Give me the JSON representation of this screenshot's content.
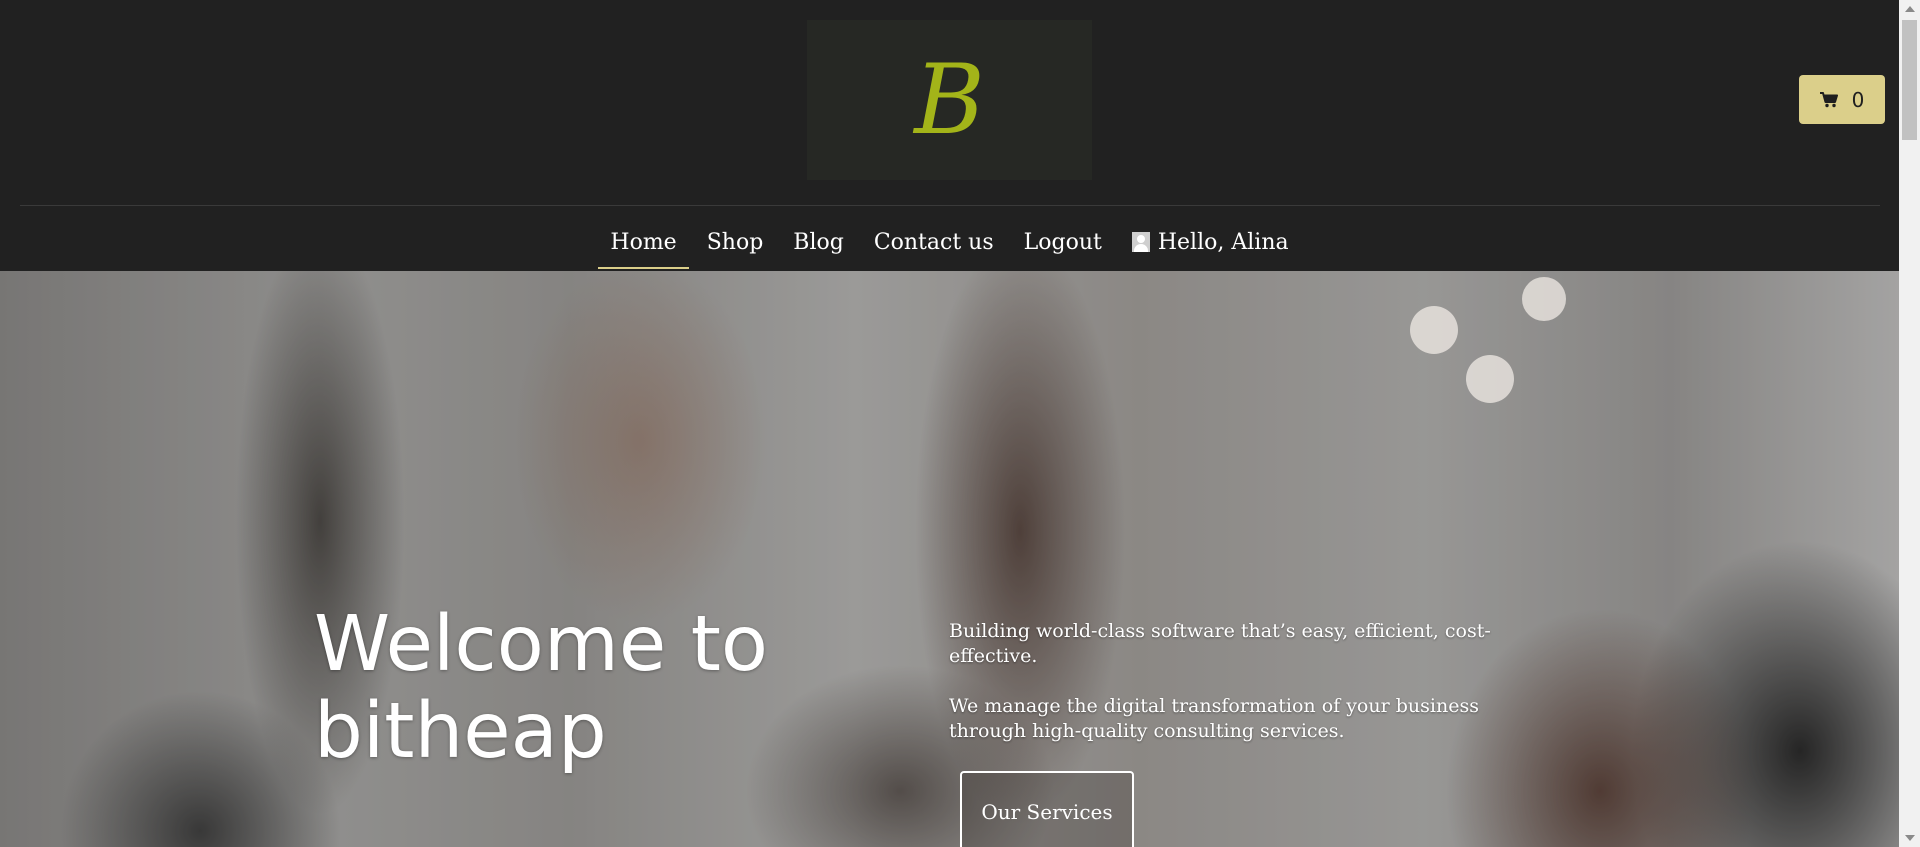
{
  "header": {
    "logo_text": "B",
    "cart": {
      "icon": "shopping-cart-icon",
      "count": "0"
    }
  },
  "nav": {
    "items": [
      {
        "label": "Home",
        "active": true
      },
      {
        "label": "Shop"
      },
      {
        "label": "Blog"
      },
      {
        "label": "Contact us"
      },
      {
        "label": "Logout"
      }
    ],
    "user": {
      "icon": "user-avatar-icon",
      "greeting": "Hello, Alina"
    }
  },
  "hero": {
    "title": "Welcome to bitheap",
    "paragraphs": [
      "Building world-class software that’s easy, efficient, cost-effective.",
      "We manage the digital transformation of your business through high-quality consulting services."
    ],
    "cta_label": "Our Services"
  },
  "colors": {
    "header_bg": "#212121",
    "logo_accent": "#a3b419",
    "cart_bg": "#dbcf8a",
    "active_underline": "#dbcf8a"
  }
}
